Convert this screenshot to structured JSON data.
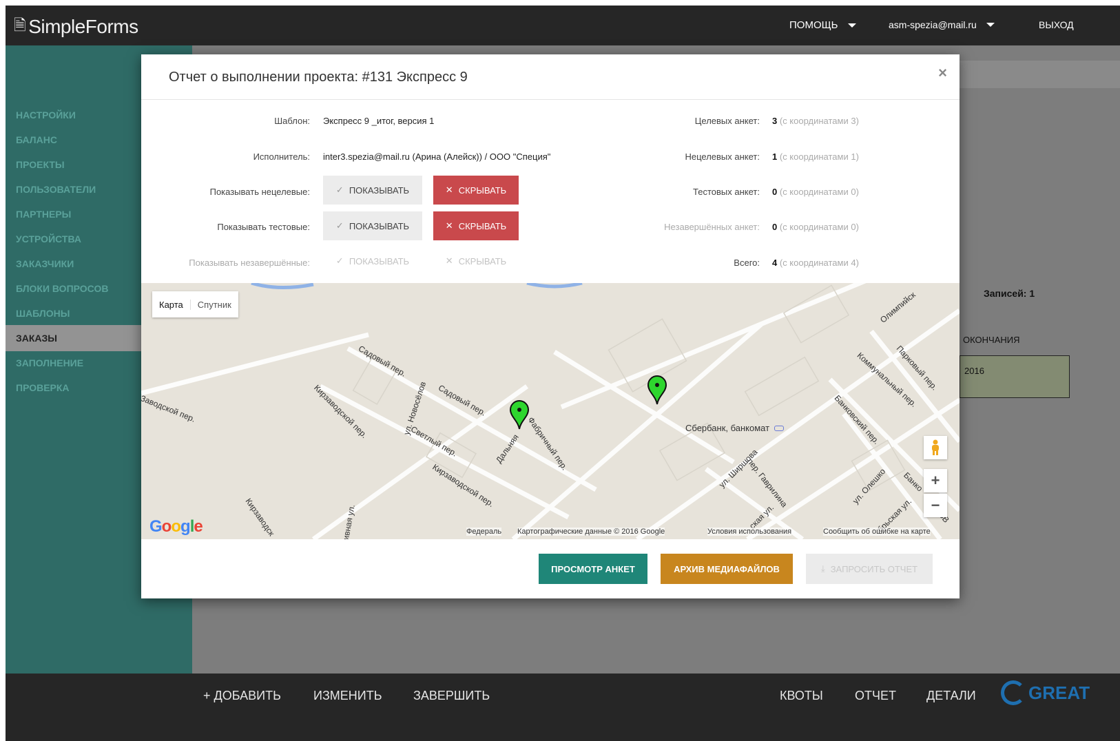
{
  "app": {
    "name": "SimpleForms"
  },
  "topnav": {
    "help": "ПОМОЩЬ",
    "user": "asm-spezia@mail.ru",
    "logout": "ВЫХОД"
  },
  "sidebar": {
    "items": [
      {
        "label": "НАСТРОЙКИ"
      },
      {
        "label": "БАЛАНС"
      },
      {
        "label": "ПРОЕКТЫ"
      },
      {
        "label": "ПОЛЬЗОВАТЕЛИ"
      },
      {
        "label": "ПАРТНЕРЫ"
      },
      {
        "label": "УСТРОЙСТВА"
      },
      {
        "label": "ЗАКАЗЧИКИ"
      },
      {
        "label": "БЛОКИ ВОПРОСОВ"
      },
      {
        "label": "ШАБЛОНЫ"
      },
      {
        "label": "ЗАКАЗЫ",
        "active": true
      },
      {
        "label": "ЗАПОЛНЕНИЕ"
      },
      {
        "label": "ПРОВЕРКА"
      }
    ]
  },
  "background": {
    "records": "Записей: 1",
    "column": "ОКОНЧАНИЯ",
    "cell": "2016"
  },
  "bottombar": {
    "add": "+ ДОБАВИТЬ",
    "edit": "ИЗМЕНИТЬ",
    "finish": "ЗАВЕРШИТЬ",
    "quotas": "КВОТЫ",
    "report": "ОТЧЕТ",
    "details": "ДЕТАЛИ",
    "brand": "GREAT"
  },
  "modal": {
    "title": "Отчет о выполнении проекта: #131 Экспресс 9",
    "close": "×",
    "template_label": "Шаблон:",
    "template_value": "Экспресс 9 _итог, версия 1",
    "executor_label": "Исполнитель:",
    "executor_value": "inter3.spezia@mail.ru (Арина (Алейск)) / ООО \"Специя\"",
    "show_nontarget_label": "Показывать нецелевые:",
    "show_test_label": "Показывать тестовые:",
    "show_incomplete_label": "Показывать незавершённые:",
    "show_btn": "ПОКАЗЫВАТЬ",
    "hide_btn": "СКРЫВАТЬ",
    "stats": {
      "target_label": "Целевых анкет:",
      "target_value": "3",
      "target_coords": "(с координатами 3)",
      "nontarget_label": "Нецелевых анкет:",
      "nontarget_value": "1",
      "nontarget_coords": "(с координатами 1)",
      "test_label": "Тестовых анкет:",
      "test_value": "0",
      "test_coords": "(с координатами 0)",
      "incomplete_label": "Незавершённых анкет:",
      "incomplete_value": "0",
      "incomplete_coords": "(с координатами 0)",
      "total_label": "Всего:",
      "total_value": "4",
      "total_coords": "(с координатами 4)"
    },
    "map": {
      "type_map": "Карта",
      "type_sat": "Спутник",
      "streets": {
        "s1": "Садовый пер.",
        "s2": "Садовый пер.",
        "s3": "Кирзаводской пер.",
        "s4": "ул. Новосёлов",
        "s5": "Светлый пер.",
        "s6": "Кирзаводской пер.",
        "s7": "Дальняя",
        "s8": "Фабричный пер.",
        "s9": "Кирзаводск",
        "s10": "ивная ул.",
        "s11": "Заводской пер.",
        "s12": "Олимпийск",
        "s13": "Коммунальный пер.",
        "s14": "Парковый пер.",
        "s15": "Банковский пер.",
        "s16": "ул. Ширшова",
        "s17": "пер. Гаврилина",
        "s18": "ул. Олешко",
        "s19": "Банко",
        "s20": "ская ул.",
        "s21": "брьская ул.",
        "s22": "ЗВ"
      },
      "poi": "Сбербанк, банкомат",
      "google": "Google",
      "federal": "Федераль",
      "attribution": "Картографические данные © 2016 Google",
      "terms": "Условия использования",
      "report_error": "Сообщить об ошибке на карте"
    },
    "actions": {
      "view": "ПРОСМОТР АНКЕТ",
      "archive": "АРХИВ МЕДИАФАЙЛОВ",
      "request": "ЗАПРОСИТЬ ОТЧЕТ"
    }
  },
  "colors": {
    "sidebar": "#2f6b66",
    "hide_button": "#c9494c",
    "view_button": "#1f8678",
    "archive_button": "#c8861e",
    "marker": "#2ed62e"
  }
}
